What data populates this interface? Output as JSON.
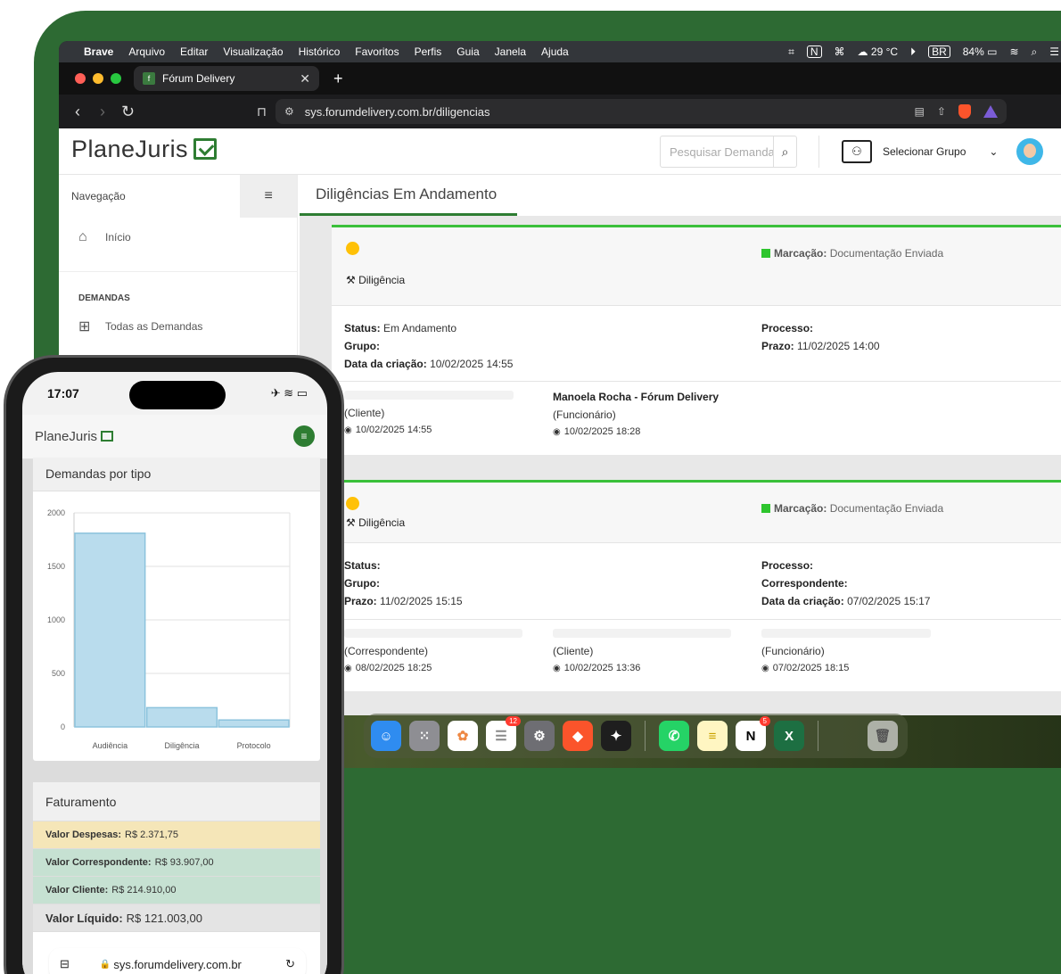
{
  "menubar": {
    "app": "Brave",
    "items": [
      "Arquivo",
      "Editar",
      "Visualização",
      "Histórico",
      "Favoritos",
      "Perfis",
      "Guia",
      "Janela",
      "Ajuda"
    ],
    "weather": "29 °C",
    "input_lang": "BR",
    "battery": "84%"
  },
  "browser": {
    "tab_title": "Fórum Delivery",
    "url": "sys.forumdelivery.com.br/diligencias"
  },
  "app": {
    "logo": "PlaneJuris",
    "search_placeholder": "Pesquisar Demanda",
    "group_label": "Selecionar Grupo",
    "sidebar": {
      "nav_label": "Navegação",
      "home": "Início",
      "section": "DEMANDAS",
      "all_demands": "Todas as Demandas"
    },
    "page_title": "Diligências Em Andamento",
    "cards": [
      {
        "type": "Diligência",
        "marcacao_label": "Marcação:",
        "marcacao_value": "Documentação Enviada",
        "status_label": "Status:",
        "status_value": "Em Andamento",
        "grupo_label": "Grupo:",
        "criacao_label": "Data da criação:",
        "criacao_value": "10/02/2025 14:55",
        "processo_label": "Processo:",
        "prazo_label": "Prazo:",
        "prazo_value": "11/02/2025 14:00",
        "people": [
          {
            "name": "",
            "role": "(Cliente)",
            "seen": "10/02/2025 14:55"
          },
          {
            "name": "Manoela Rocha - Fórum Delivery",
            "role": "(Funcionário)",
            "seen": "10/02/2025 18:28"
          }
        ]
      },
      {
        "type": "Diligência",
        "marcacao_label": "Marcação:",
        "marcacao_value": "Documentação Enviada",
        "status_label": "Status:",
        "grupo_label": "Grupo:",
        "prazo_label": "Prazo:",
        "prazo_value": "11/02/2025 15:15",
        "processo_label": "Processo:",
        "correspondente_label": "Correspondente:",
        "criacao_label": "Data da criação:",
        "criacao_value": "07/02/2025 15:17",
        "people": [
          {
            "role": "(Correspondente)",
            "seen": "08/02/2025 18:25"
          },
          {
            "role": "(Cliente)",
            "seen": "10/02/2025 13:36"
          },
          {
            "role": "(Funcionário)",
            "seen": "07/02/2025 18:15"
          }
        ]
      }
    ]
  },
  "dock": {
    "apps": [
      "finder",
      "launchpad",
      "photos",
      "reminders",
      "system-settings",
      "brave",
      "figma",
      "whatsapp",
      "notes",
      "notion",
      "excel",
      "trash"
    ],
    "reminders_badge": "12",
    "notion_badge": "5"
  },
  "phone": {
    "time": "17:07",
    "logo": "PlaneJuris",
    "chart_title": "Demandas por tipo",
    "faturamento_title": "Faturamento",
    "faturamento": [
      {
        "label": "Valor Despesas:",
        "value": "R$ 2.371,75",
        "color": "#f5e6b8"
      },
      {
        "label": "Valor Correspondente:",
        "value": "R$ 93.907,00",
        "color": "#c6e1d2"
      },
      {
        "label": "Valor Cliente:",
        "value": "R$ 214.910,00",
        "color": "#c6e1d2"
      },
      {
        "label": "Valor Líquido:",
        "value": "R$ 121.003,00",
        "color": "#e4e4e4"
      }
    ],
    "url": "sys.forumdelivery.com.br"
  },
  "chart_data": {
    "type": "bar",
    "title": "Demandas por tipo",
    "categories": [
      "Audiência",
      "Diligência",
      "Protocolo"
    ],
    "values": [
      1810,
      180,
      65
    ],
    "ylim": [
      0,
      2000
    ],
    "yticks": [
      0,
      500,
      1000,
      1500,
      2000
    ],
    "grid": true,
    "bar_color": "#b9dced",
    "bar_border": "#8cc3dd"
  }
}
